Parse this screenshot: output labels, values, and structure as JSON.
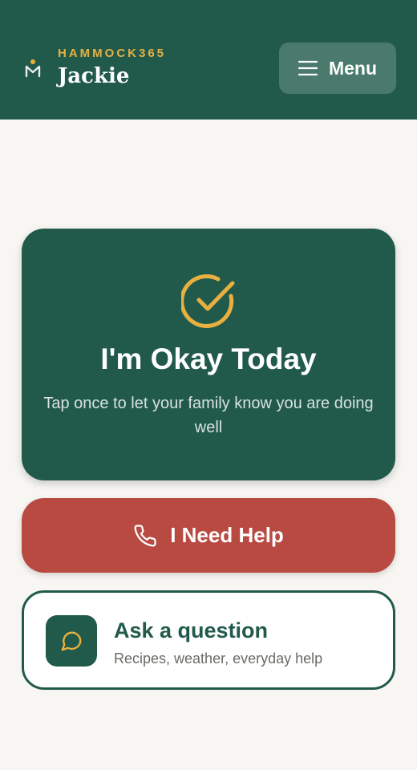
{
  "header": {
    "brand": "HAMMOCK365",
    "user_name": "Jackie",
    "menu_label": "Menu",
    "logo_icon": "hammock-logo-icon",
    "menu_icon": "hamburger-icon"
  },
  "ok_card": {
    "title": "I'm Okay Today",
    "subtitle": "Tap once to let your family know you are doing well",
    "icon": "check-circle-icon"
  },
  "help_button": {
    "label": "I Need Help",
    "icon": "phone-icon"
  },
  "ask_card": {
    "title": "Ask a question",
    "subtitle": "Recipes, weather, everyday help",
    "icon": "chat-bubble-icon"
  },
  "colors": {
    "primary_green": "#215a4b",
    "accent_gold": "#e9b040",
    "help_red": "#b84a42",
    "background": "#f8f6f2"
  }
}
